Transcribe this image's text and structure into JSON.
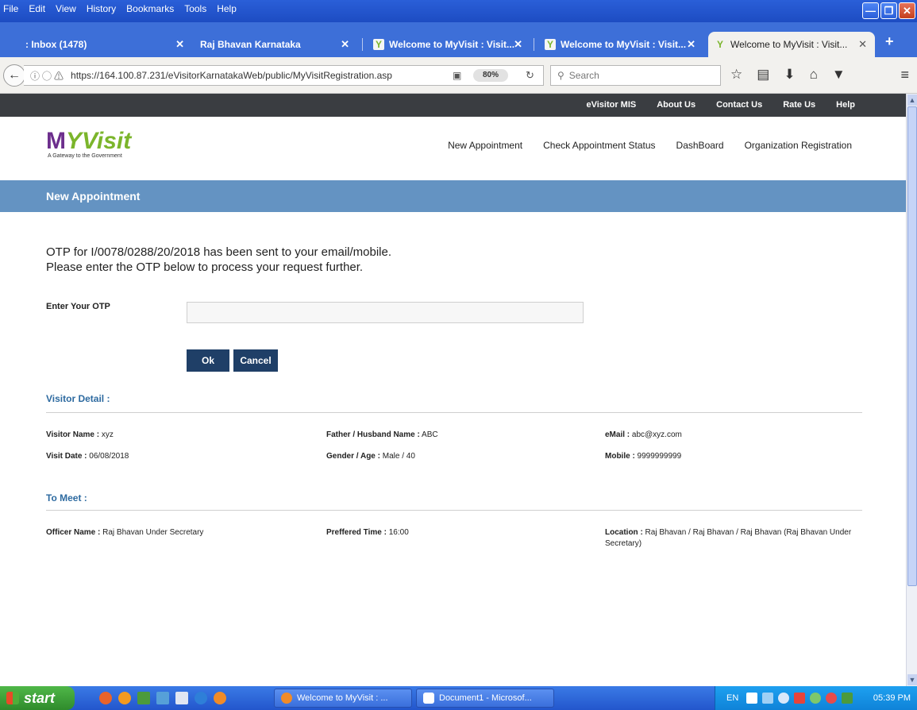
{
  "browser": {
    "menu": [
      "File",
      "Edit",
      "View",
      "History",
      "Bookmarks",
      "Tools",
      "Help"
    ],
    "tabs": [
      {
        "label": ": Inbox (1478)"
      },
      {
        "label": "Raj Bhavan Karnataka"
      },
      {
        "label": "Welcome to MyVisit : Visit..."
      },
      {
        "label": "Welcome to MyVisit : Visit..."
      },
      {
        "label": "Welcome to MyVisit : Visit..."
      }
    ],
    "url": "https://164.100.87.231/eVisitorKarnatakaWeb/public/MyVisitRegistration.asp",
    "zoom": "80%",
    "search_placeholder": "Search"
  },
  "site": {
    "top_links": [
      "eVisitor MIS",
      "About Us",
      "Contact Us",
      "Rate Us",
      "Help"
    ],
    "logo_text": "MYVisit",
    "logo_tagline": "A Gateway to the Government",
    "nav": [
      "New Appointment",
      "Check Appointment Status",
      "DashBoard",
      "Organization Registration"
    ],
    "section_title": "New Appointment"
  },
  "otp": {
    "message_line1": "OTP for I/0078/0288/20/2018 has been sent to your email/mobile.",
    "message_line2": "Please enter the OTP below to process your request further.",
    "label": "Enter Your OTP",
    "value": "",
    "ok_label": "Ok",
    "cancel_label": "Cancel"
  },
  "visitor": {
    "heading": "Visitor Detail :",
    "name_label": "Visitor Name :",
    "name": " xyz",
    "father_label": "Father / Husband Name :",
    "father": " ABC",
    "email_label": "eMail :",
    "email": " abc@xyz.com",
    "date_label": "Visit Date :",
    "date": " 06/08/2018",
    "gender_label": "Gender / Age :",
    "gender": " Male / 40",
    "mobile_label": "Mobile :",
    "mobile": " 9999999999"
  },
  "meet": {
    "heading": "To Meet :",
    "officer_label": "Officer Name :",
    "officer": " Raj Bhavan Under Secretary",
    "time_label": "Preffered Time :",
    "time": " 16:00",
    "location_label": "Location :",
    "location": " Raj Bhavan / Raj Bhavan / Raj Bhavan (Raj Bhavan Under Secretary)"
  },
  "taskbar": {
    "start": "start",
    "items": [
      "Welcome to MyVisit : ...",
      "Document1 - Microsof..."
    ],
    "lang": "EN",
    "clock": "05:39 PM"
  },
  "colors": {
    "section_band": "#6493c2",
    "button": "#1f3f67",
    "subheading": "#2d6aa0",
    "logo_green": "#7bb52b",
    "logo_purple": "#6d2f8d"
  }
}
